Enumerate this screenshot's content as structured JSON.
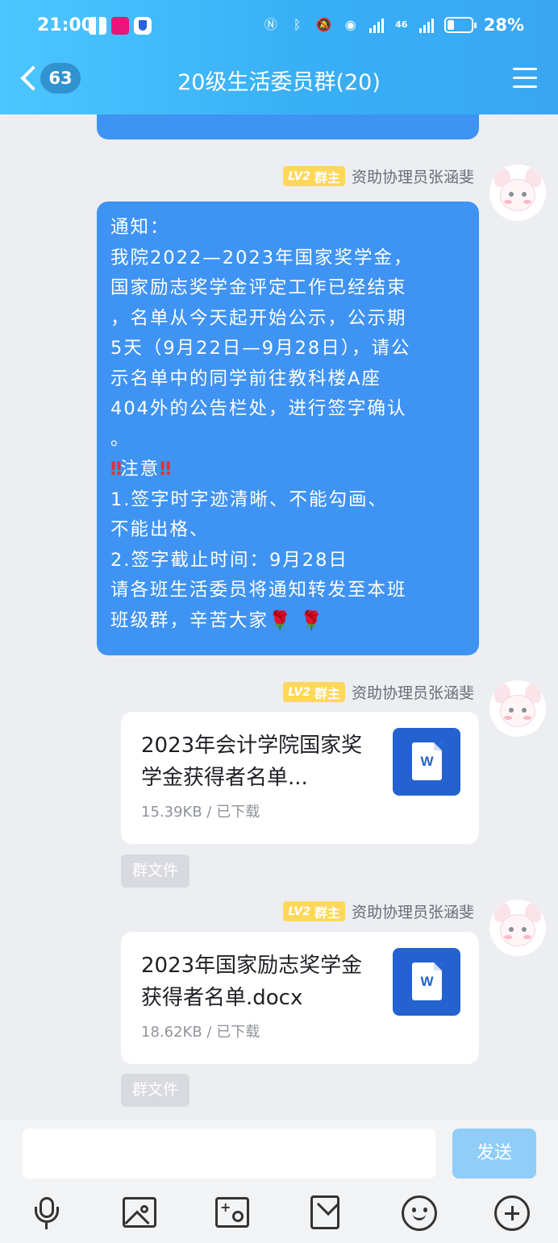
{
  "status_bar": {
    "time": "21:00",
    "network_label": "46",
    "battery_percent": "28%",
    "battery_level": 0.28,
    "icons": [
      "gift-icon",
      "app-store-icon",
      "shield-icon",
      "nfc-icon",
      "bluetooth-icon",
      "mute-bell-icon",
      "hotspot-icon",
      "signal-icon",
      "battery-icon"
    ]
  },
  "header": {
    "unread_count": "63",
    "title": "20级生活委员群(20)",
    "accent_color": "#3aaaf4"
  },
  "messages": [
    {
      "sender_badge_level": "LV2",
      "sender_badge_role": "群主",
      "sender_name": "资助协理员张涵斐",
      "notice_lines": [
        "通知：",
        " 我院2022—2023年国家奖学金，",
        "国家励志奖学金评定工作已经结束",
        "，名单从今天起开始公示，公示期",
        "5天（9月22日—9月28日），请公",
        "示名单中的同学前往教科楼A座",
        "404外的公告栏处，进行签字确认",
        "。"
      ],
      "attention_text": "注意",
      "attention_mark": "‼",
      "rules_lines": [
        "1.签字时字迹清晰、不能勾画、",
        "不能出格、",
        "2.签字截止时间：9月28日",
        "请各班生活委员将通知转发至本班"
      ],
      "closing_line": "班级群，辛苦大家",
      "closing_emoji": "🌹 🌹"
    },
    {
      "sender_badge_level": "LV2",
      "sender_badge_role": "群主",
      "sender_name": "资助协理员张涵斐",
      "file_name": "2023年会计学院国家奖学金获得者名单...",
      "file_meta": "15.39KB / 已下载",
      "file_icon_letter": "W",
      "group_file_label": "群文件"
    },
    {
      "sender_badge_level": "LV2",
      "sender_badge_role": "群主",
      "sender_name": "资助协理员张涵斐",
      "file_name": "2023年国家励志奖学金获得者名单.docx",
      "file_meta": "18.62KB / 已下载",
      "file_icon_letter": "W",
      "group_file_label": "群文件"
    }
  ],
  "input_bar": {
    "send_label": "发送",
    "tools": [
      "microphone-icon",
      "image-icon",
      "camera-icon",
      "red-packet-icon",
      "emoji-icon",
      "plus-icon"
    ]
  }
}
